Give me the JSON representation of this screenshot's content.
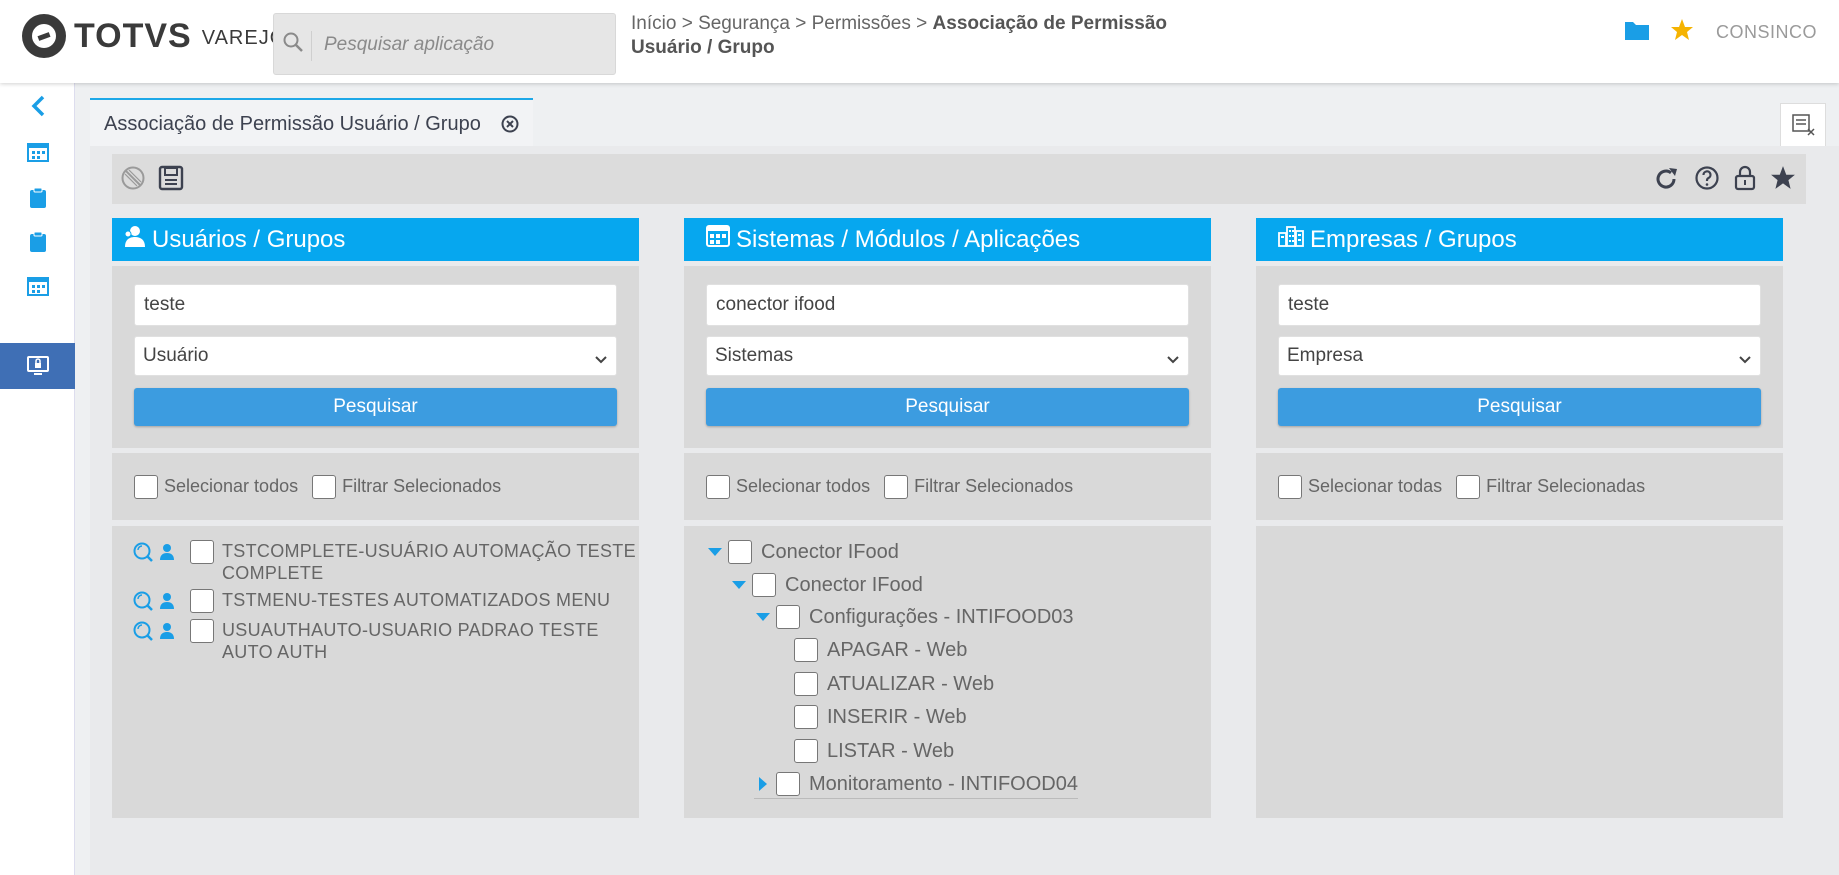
{
  "header": {
    "logo_text": "TOTVS",
    "logo_sub": "VAREJO",
    "search_placeholder": "Pesquisar aplicação",
    "breadcrumb": {
      "part1": "Início > Segurança > Permissões > ",
      "current": "Associação de Permissão Usuário / Grupo"
    },
    "user_name": "CONSINCO"
  },
  "tab": {
    "label": "Associação de Permissão Usuário / Grupo"
  },
  "panels": {
    "users": {
      "title": "Usuários / Grupos",
      "search_value": "teste",
      "select_value": "Usuário",
      "button": "Pesquisar",
      "select_all": "Selecionar todos",
      "filter_selected": "Filtrar Selecionados",
      "items": [
        {
          "label": "TSTCOMPLETE-USUÁRIO AUTOMAÇÃO TESTE COMPLETE"
        },
        {
          "label": "TSTMENU-TESTES AUTOMATIZADOS MENU"
        },
        {
          "label": "USUAUTHAUTO-USUARIO PADRAO TESTE AUTO AUTH"
        }
      ]
    },
    "systems": {
      "title": "Sistemas / Módulos / Aplicações",
      "search_value": "conector ifood",
      "select_value": "Sistemas",
      "button": "Pesquisar",
      "select_all": "Selecionar todos",
      "filter_selected": "Filtrar Selecionados",
      "tree": [
        {
          "label": "Conector IFood"
        },
        {
          "label": "Conector IFood"
        },
        {
          "label": "Configurações - INTIFOOD03"
        },
        {
          "label": "APAGAR - Web"
        },
        {
          "label": "ATUALIZAR - Web"
        },
        {
          "label": "INSERIR - Web"
        },
        {
          "label": "LISTAR - Web"
        },
        {
          "label": "Monitoramento - INTIFOOD04"
        }
      ]
    },
    "companies": {
      "title": "Empresas / Grupos",
      "search_value": "teste",
      "select_value": "Empresa",
      "button": "Pesquisar",
      "select_all": "Selecionar todas",
      "filter_selected": "Filtrar Selecionadas"
    }
  },
  "colors": {
    "accent": "#06a7ef",
    "button": "#3c9ce0",
    "rail_active": "#3f6fb5",
    "star": "#f5b301"
  }
}
